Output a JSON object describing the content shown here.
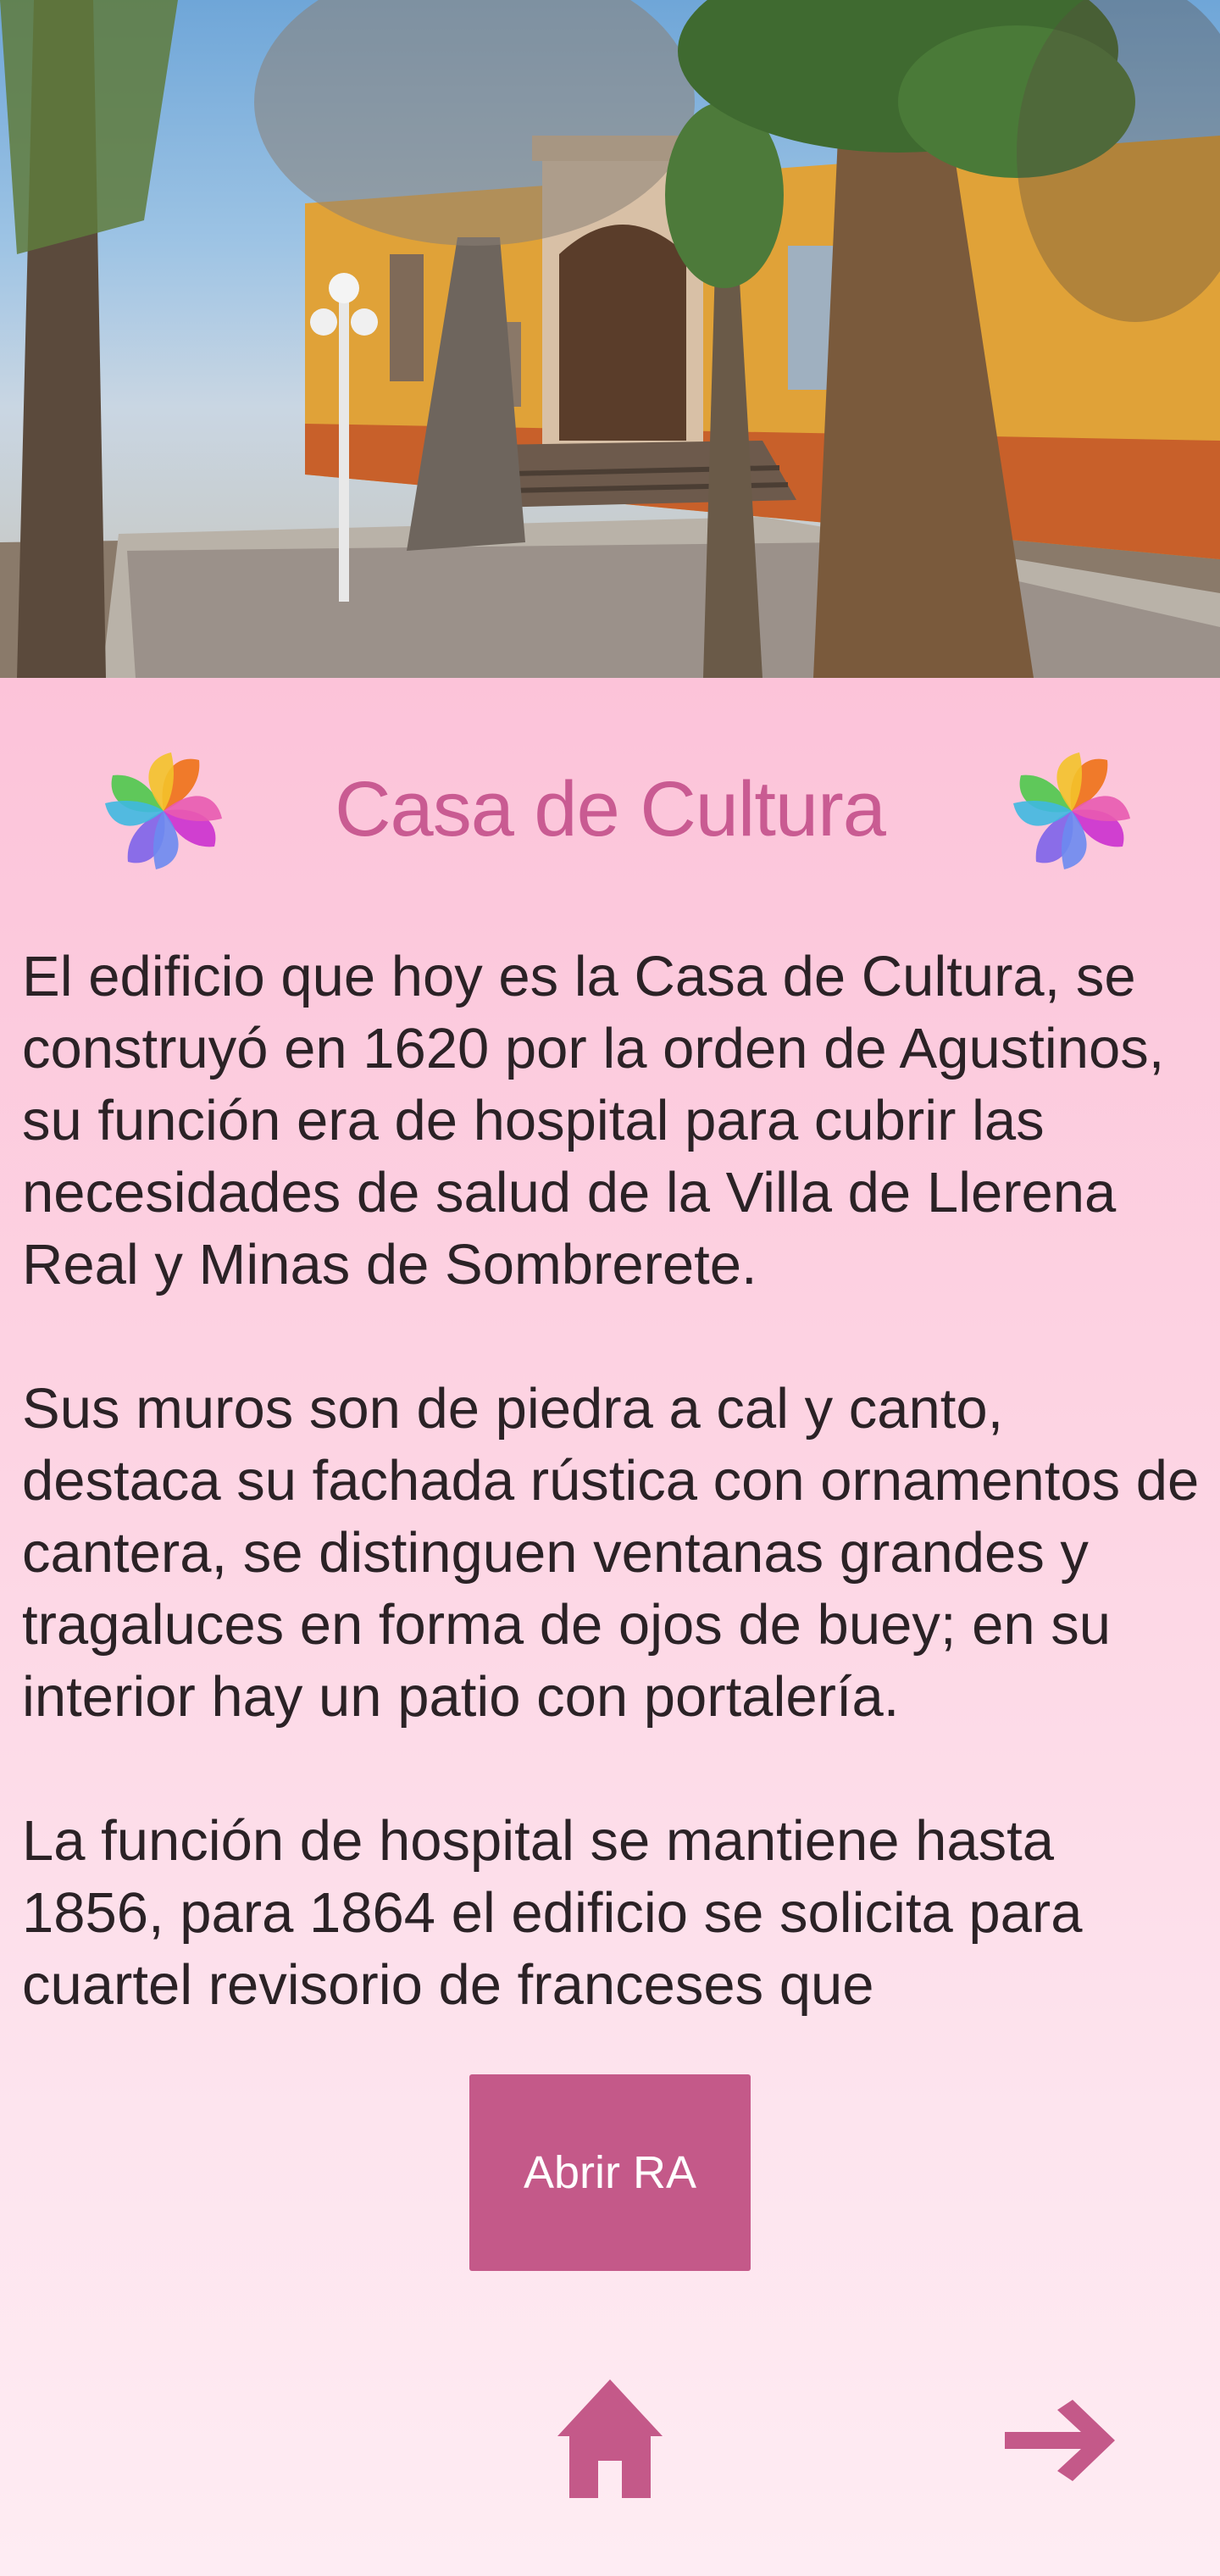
{
  "page": {
    "title": "Casa de Cultura",
    "paragraphs": [
      "El edificio que hoy es la Casa de Cultura, se construyó en 1620 por la orden de Agustinos, su función era de hospital para cubrir las necesidades de salud de la Villa de Llerena Real y Minas de Sombrerete.",
      "Sus muros son de piedra a cal y canto, destaca su fachada rústica con ornamentos de cantera, se distinguen ventanas grandes y tragaluces en forma de ojos de buey; en su interior hay un patio con portalería.",
      "La función de hospital se mantiene hasta 1856, para 1864 el edificio se solicita para cuartel revisorio de franceses que"
    ],
    "ar_button_label": "Abrir RA"
  },
  "icons": {
    "title_decoration": "pinwheel-icon",
    "home": "home-icon",
    "next": "arrow-right-icon"
  },
  "colors": {
    "accent": "#c45989",
    "title": "#c95b92",
    "body_text": "#2b2226",
    "background_top": "#fbb1cf",
    "background_bottom": "#feecf3"
  }
}
